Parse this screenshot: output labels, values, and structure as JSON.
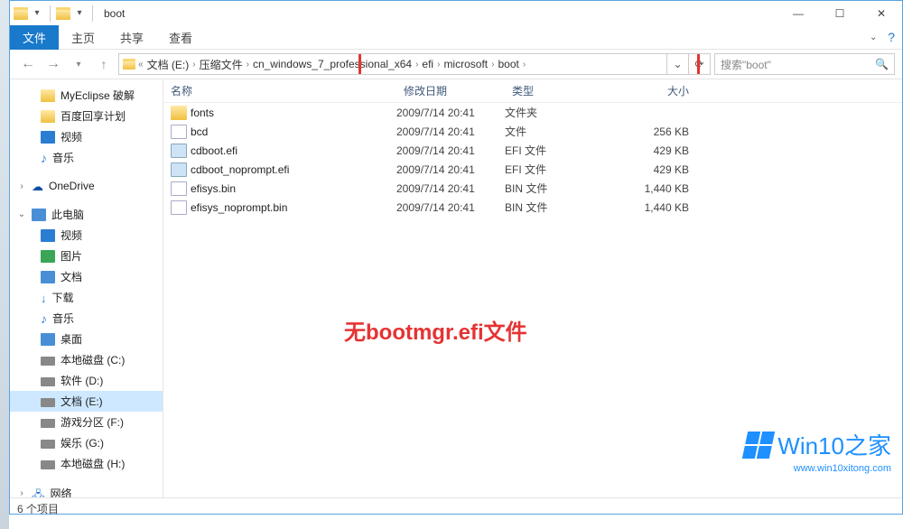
{
  "titlebar": {
    "title": "boot"
  },
  "ribbon": {
    "file": "文件",
    "tabs": [
      "主页",
      "共享",
      "查看"
    ]
  },
  "breadcrumbs": [
    "文档 (E:)",
    "压缩文件",
    "cn_windows_7_professional_x64",
    "efi",
    "microsoft",
    "boot"
  ],
  "search": {
    "placeholder": "搜索\"boot\""
  },
  "sidebar": {
    "items": [
      {
        "label": "MyEclipse 破解",
        "icon": "ic-folder",
        "level": 2
      },
      {
        "label": "百度回享计划",
        "icon": "ic-folder",
        "level": 2
      },
      {
        "label": "视频",
        "icon": "ic-video",
        "level": 2
      },
      {
        "label": "音乐",
        "icon": "ic-music",
        "glyph": "♪",
        "level": 2
      }
    ],
    "onedrive": {
      "label": "OneDrive",
      "glyph": "☁"
    },
    "thispc": {
      "label": "此电脑",
      "children": [
        {
          "label": "视频",
          "icon": "ic-video"
        },
        {
          "label": "图片",
          "icon": "ic-pic"
        },
        {
          "label": "文档",
          "icon": "ic-doc"
        },
        {
          "label": "下载",
          "icon": "ic-dl",
          "glyph": "↓"
        },
        {
          "label": "音乐",
          "icon": "ic-music",
          "glyph": "♪"
        },
        {
          "label": "桌面",
          "icon": "ic-desktop"
        },
        {
          "label": "本地磁盘 (C:)",
          "icon": "ic-drive"
        },
        {
          "label": "软件 (D:)",
          "icon": "ic-drive"
        },
        {
          "label": "文档 (E:)",
          "icon": "ic-drive",
          "selected": true
        },
        {
          "label": "游戏分区 (F:)",
          "icon": "ic-drive"
        },
        {
          "label": "娱乐 (G:)",
          "icon": "ic-drive"
        },
        {
          "label": "本地磁盘 (H:)",
          "icon": "ic-drive"
        }
      ]
    },
    "network": {
      "label": "网络",
      "glyph": "🖧"
    }
  },
  "columns": {
    "name": "名称",
    "date": "修改日期",
    "type": "类型",
    "size": "大小"
  },
  "files": [
    {
      "name": "fonts",
      "date": "2009/7/14 20:41",
      "type": "文件夹",
      "size": "",
      "icon": "fic-folder"
    },
    {
      "name": "bcd",
      "date": "2009/7/14 20:41",
      "type": "文件",
      "size": "256 KB",
      "icon": "fic-file"
    },
    {
      "name": "cdboot.efi",
      "date": "2009/7/14 20:41",
      "type": "EFI 文件",
      "size": "429 KB",
      "icon": "fic-efi"
    },
    {
      "name": "cdboot_noprompt.efi",
      "date": "2009/7/14 20:41",
      "type": "EFI 文件",
      "size": "429 KB",
      "icon": "fic-efi"
    },
    {
      "name": "efisys.bin",
      "date": "2009/7/14 20:41",
      "type": "BIN 文件",
      "size": "1,440 KB",
      "icon": "fic-file"
    },
    {
      "name": "efisys_noprompt.bin",
      "date": "2009/7/14 20:41",
      "type": "BIN 文件",
      "size": "1,440 KB",
      "icon": "fic-file"
    }
  ],
  "annotation": "无bootmgr.efi文件",
  "status": "6 个项目",
  "watermark": {
    "brand": "Win10",
    "suffix": "之家",
    "url": "www.win10xitong.com"
  }
}
